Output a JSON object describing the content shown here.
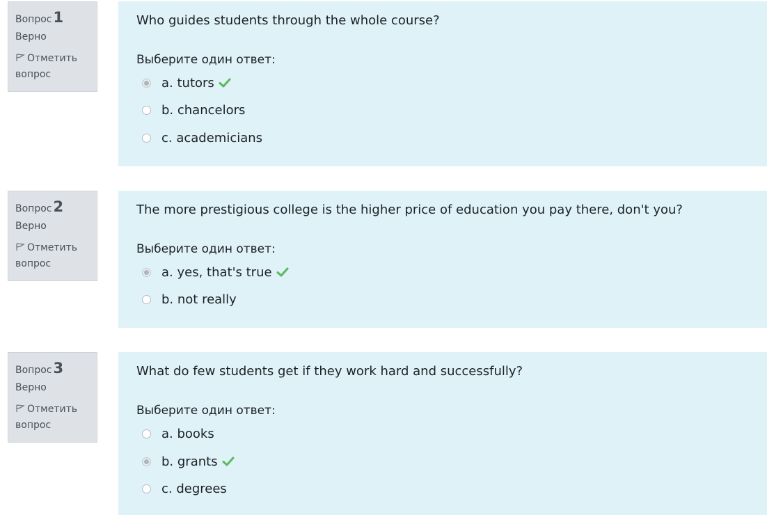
{
  "questions": [
    {
      "label": "Вопрос",
      "number": "1",
      "state": "Верно",
      "flag_line1": "Отметить",
      "flag_line2": "вопрос",
      "text": "Who guides students through the whole course?",
      "prompt": "Выберите один ответ:",
      "answers": [
        {
          "text": "a. tutors",
          "selected": true,
          "correct": true
        },
        {
          "text": "b. chancelors",
          "selected": false,
          "correct": false
        },
        {
          "text": "c. academicians",
          "selected": false,
          "correct": false
        }
      ]
    },
    {
      "label": "Вопрос",
      "number": "2",
      "state": "Верно",
      "flag_line1": "Отметить",
      "flag_line2": "вопрос",
      "text": "The more prestigious college is the higher price of education you pay there, don't you?",
      "prompt": "Выберите один ответ:",
      "answers": [
        {
          "text": "a. yes, that's true",
          "selected": true,
          "correct": true
        },
        {
          "text": "b. not really",
          "selected": false,
          "correct": false
        }
      ]
    },
    {
      "label": "Вопрос",
      "number": "3",
      "state": "Верно",
      "flag_line1": "Отметить",
      "flag_line2": "вопрос",
      "text": "What do few students get if they work hard and successfully?",
      "prompt": "Выберите один ответ:",
      "answers": [
        {
          "text": "a. books",
          "selected": false,
          "correct": false
        },
        {
          "text": "b. grants",
          "selected": true,
          "correct": true
        },
        {
          "text": "c. degrees",
          "selected": false,
          "correct": false
        }
      ]
    }
  ],
  "colors": {
    "info_bg": "#dee2e6",
    "content_bg": "#def2f8",
    "correct_check": "#5cb85c"
  },
  "icons": {
    "flag": "flag-icon",
    "correct": "check-icon"
  }
}
